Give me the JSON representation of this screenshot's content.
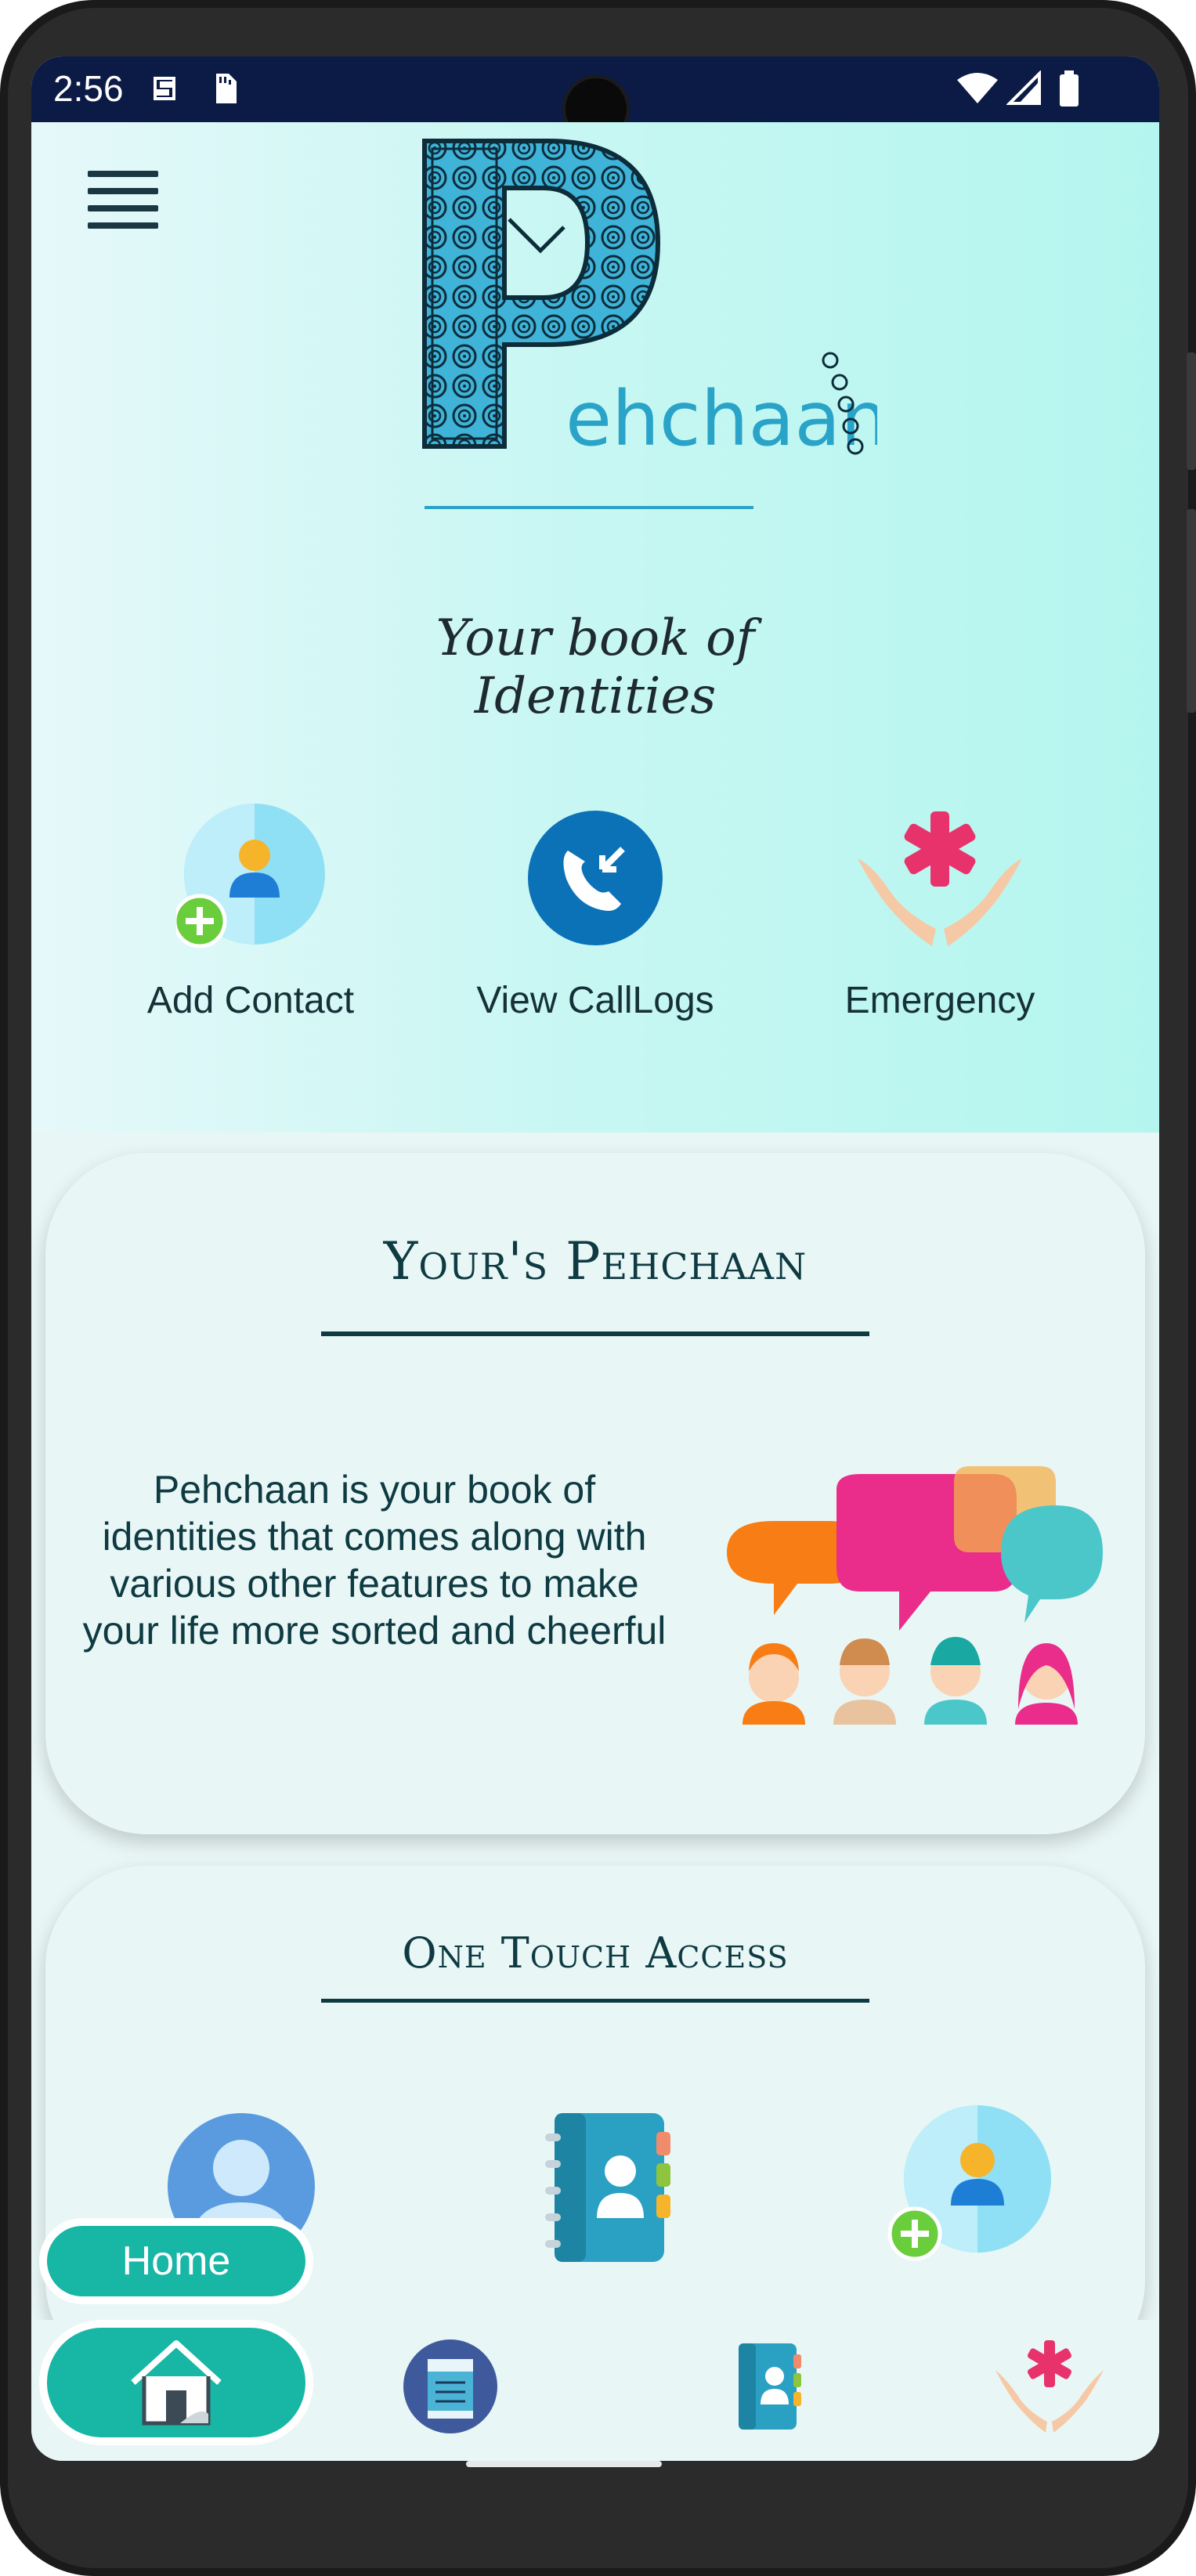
{
  "status_bar": {
    "time": "2:56"
  },
  "header": {
    "brand_text": "ehchaan",
    "tagline": "Your book of Identities"
  },
  "quick_actions": [
    {
      "label": "Add Contact",
      "icon": "add-contact-icon"
    },
    {
      "label": "View CallLogs",
      "icon": "call-logs-icon"
    },
    {
      "label": "Emergency",
      "icon": "emergency-icon"
    }
  ],
  "intro_card": {
    "title": "Your's Pehchaan",
    "text": "Pehchaan is your book of identities that comes along with various other features to make your life more sorted and cheerful"
  },
  "access_card": {
    "title": "One Touch Access",
    "items": [
      {
        "icon": "profile-icon"
      },
      {
        "icon": "phone-book-icon"
      },
      {
        "icon": "add-contact-icon"
      }
    ]
  },
  "bottom_nav": {
    "active_label": "Home",
    "items": [
      "home-icon",
      "notes-icon",
      "phone-book-icon",
      "emergency-icon"
    ]
  },
  "colors": {
    "status_bar": "#0c1b45",
    "accent": "#18b6a5",
    "text_dark": "#0e3a42",
    "hero_gradient_end": "#b4f6ef"
  }
}
